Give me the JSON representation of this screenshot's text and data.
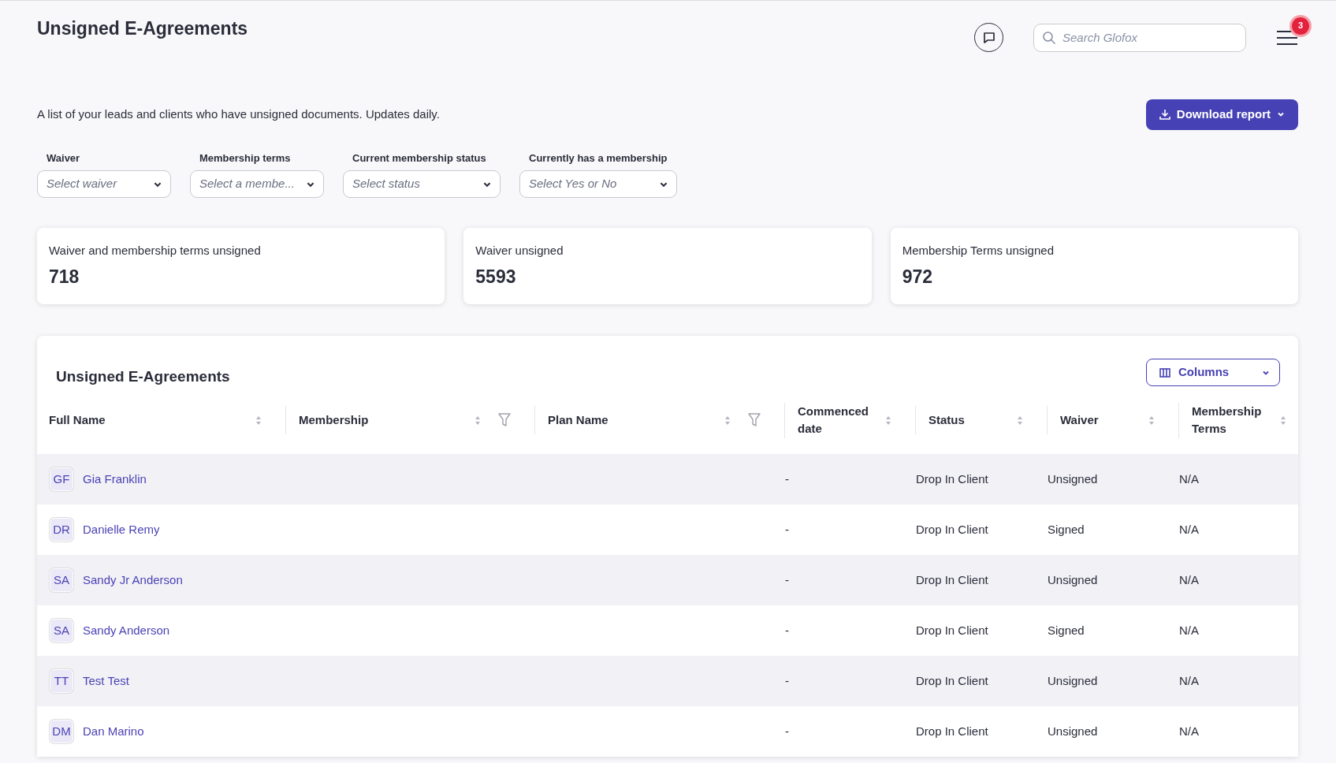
{
  "header": {
    "title": "Unsigned E-Agreements",
    "search": {
      "placeholder": "Search Glofox"
    },
    "notifications": "3"
  },
  "description": "A list of your leads and clients who have unsigned documents. Updates daily.",
  "download_button": "Download report",
  "filters": [
    {
      "label": "Waiver",
      "placeholder": "Select waiver"
    },
    {
      "label": "Membership terms",
      "placeholder": "Select a membe..."
    },
    {
      "label": "Current membership status",
      "placeholder": "Select status"
    },
    {
      "label": "Currently has a membership",
      "placeholder": "Select Yes or No"
    }
  ],
  "stats": [
    {
      "label": "Waiver and membership terms unsigned",
      "value": "718"
    },
    {
      "label": "Waiver unsigned",
      "value": "5593"
    },
    {
      "label": "Membership Terms unsigned",
      "value": "972"
    }
  ],
  "table": {
    "title": "Unsigned E-Agreements",
    "columns_button": "Columns",
    "columns": [
      {
        "label": "Full Name",
        "filterable": false
      },
      {
        "label": "Membership",
        "filterable": true
      },
      {
        "label": "Plan Name",
        "filterable": true
      },
      {
        "label": "Commenced date",
        "filterable": false
      },
      {
        "label": "Status",
        "filterable": false
      },
      {
        "label": "Waiver",
        "filterable": false
      },
      {
        "label": "Membership Terms",
        "filterable": false
      }
    ],
    "rows": [
      {
        "initials": "GF",
        "name": "Gia Franklin",
        "commenced": "-",
        "status": "Drop In Client",
        "waiver": "Unsigned",
        "terms": "N/A"
      },
      {
        "initials": "DR",
        "name": "Danielle Remy",
        "commenced": "-",
        "status": "Drop In Client",
        "waiver": "Signed",
        "terms": "N/A"
      },
      {
        "initials": "SA",
        "name": "Sandy Jr Anderson",
        "commenced": "-",
        "status": "Drop In Client",
        "waiver": "Unsigned",
        "terms": "N/A"
      },
      {
        "initials": "SA",
        "name": "Sandy Anderson",
        "commenced": "-",
        "status": "Drop In Client",
        "waiver": "Signed",
        "terms": "N/A"
      },
      {
        "initials": "TT",
        "name": "Test Test",
        "commenced": "-",
        "status": "Drop In Client",
        "waiver": "Unsigned",
        "terms": "N/A"
      },
      {
        "initials": "DM",
        "name": "Dan Marino",
        "commenced": "-",
        "status": "Drop In Client",
        "waiver": "Unsigned",
        "terms": "N/A"
      }
    ]
  }
}
